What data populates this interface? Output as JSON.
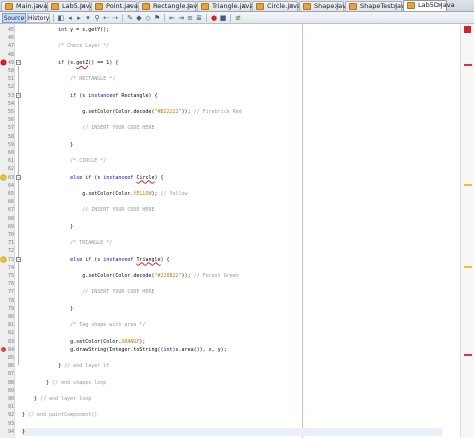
{
  "tabs": [
    {
      "label": "Main.java",
      "active": false
    },
    {
      "label": "Lab5.java",
      "active": false
    },
    {
      "label": "Point.java",
      "active": false
    },
    {
      "label": "Rectangle.java",
      "active": false
    },
    {
      "label": "Triangle.java",
      "active": false
    },
    {
      "label": "Circle.java",
      "active": false
    },
    {
      "label": "Shape.java",
      "active": false
    },
    {
      "label": "ShapeTest.java",
      "active": false
    },
    {
      "label": "Lab5D.java",
      "active": true
    }
  ],
  "toolbar": {
    "source_label": "Source",
    "history_label": "History"
  },
  "editor": {
    "lines": [
      {
        "num": "45",
        "marker": "",
        "text": "            int y = s.getY();"
      },
      {
        "num": "46",
        "marker": "",
        "text": ""
      },
      {
        "num": "47",
        "marker": "",
        "text": "            /* Check Layer */"
      },
      {
        "num": "48",
        "marker": "",
        "text": ""
      },
      {
        "num": "49",
        "marker": "err",
        "text": "            if (s.getZ() == 1) {"
      },
      {
        "num": "50",
        "marker": "",
        "text": ""
      },
      {
        "num": "51",
        "marker": "",
        "text": "                /* RECTANGLE */"
      },
      {
        "num": "52",
        "marker": "",
        "text": ""
      },
      {
        "num": "53",
        "marker": "",
        "text": "                if (s instanceof Rectangle) {"
      },
      {
        "num": "54",
        "marker": "",
        "text": ""
      },
      {
        "num": "55",
        "marker": "",
        "text": "                    g.setColor(Color.decode(\"#B22222\")); // Firebrick Red"
      },
      {
        "num": "56",
        "marker": "",
        "text": ""
      },
      {
        "num": "57",
        "marker": "",
        "text": "                    // INSERT YOUR CODE HERE"
      },
      {
        "num": "58",
        "marker": "",
        "text": ""
      },
      {
        "num": "59",
        "marker": "",
        "text": "                }"
      },
      {
        "num": "60",
        "marker": "",
        "text": ""
      },
      {
        "num": "61",
        "marker": "",
        "text": "                /* CIRCLE */"
      },
      {
        "num": "62",
        "marker": "",
        "text": ""
      },
      {
        "num": "63",
        "marker": "bulb",
        "text": "                else if (s instanceof Circle) {"
      },
      {
        "num": "64",
        "marker": "",
        "text": ""
      },
      {
        "num": "65",
        "marker": "",
        "text": "                    g.setColor(Color.YELLOW); // Yellow"
      },
      {
        "num": "66",
        "marker": "",
        "text": ""
      },
      {
        "num": "67",
        "marker": "",
        "text": "                    // INSERT YOUR CODE HERE"
      },
      {
        "num": "68",
        "marker": "",
        "text": ""
      },
      {
        "num": "69",
        "marker": "",
        "text": "                }"
      },
      {
        "num": "70",
        "marker": "",
        "text": ""
      },
      {
        "num": "71",
        "marker": "",
        "text": "                /* TRIANGLE */"
      },
      {
        "num": "72",
        "marker": "",
        "text": ""
      },
      {
        "num": "73",
        "marker": "bulb",
        "text": "                else if (s instanceof Triangle) {"
      },
      {
        "num": "74",
        "marker": "",
        "text": ""
      },
      {
        "num": "75",
        "marker": "",
        "text": "                    g.setColor(Color.decode(\"#228B22\")); // Forest Green"
      },
      {
        "num": "76",
        "marker": "",
        "text": ""
      },
      {
        "num": "77",
        "marker": "",
        "text": "                    // INSERT YOUR CODE HERE"
      },
      {
        "num": "78",
        "marker": "",
        "text": ""
      },
      {
        "num": "79",
        "marker": "",
        "text": "                }"
      },
      {
        "num": "80",
        "marker": "",
        "text": ""
      },
      {
        "num": "81",
        "marker": "",
        "text": "                /* Tag shape with area */"
      },
      {
        "num": "82",
        "marker": "",
        "text": ""
      },
      {
        "num": "83",
        "marker": "",
        "text": "                g.setColor(Color.ORANGE);"
      },
      {
        "num": "84",
        "marker": "info",
        "text": "                g.drawString(Integer.toString((int)s.area()), x, y);"
      },
      {
        "num": "85",
        "marker": "",
        "text": ""
      },
      {
        "num": "86",
        "marker": "",
        "text": "            } // end layer if"
      },
      {
        "num": "87",
        "marker": "",
        "text": ""
      },
      {
        "num": "88",
        "marker": "",
        "text": "        } // end shapes loop"
      },
      {
        "num": "89",
        "marker": "",
        "text": ""
      },
      {
        "num": "90",
        "marker": "",
        "text": "    } // end layer loop"
      },
      {
        "num": "91",
        "marker": "",
        "text": ""
      },
      {
        "num": "92",
        "marker": "",
        "text": "} // end paintComponent()"
      },
      {
        "num": "93",
        "marker": "",
        "text": ""
      },
      {
        "num": "94",
        "marker": "",
        "text": "}"
      }
    ]
  },
  "colors": {
    "keyword": "#0000e6",
    "comment": "#969696",
    "string": "#ce7b00",
    "field": "#00913a",
    "error": "#d8212a",
    "hint": "#f2c21e"
  }
}
